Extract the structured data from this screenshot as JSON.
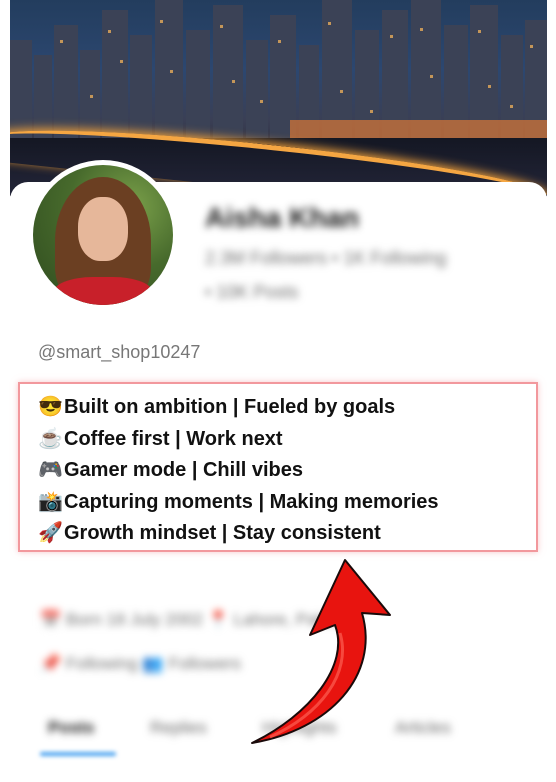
{
  "profile": {
    "name": "Aisha Khan",
    "stats_line1": "2.3M Followers • 1K Following",
    "stats_line2": "• 10K Posts",
    "username": "@smart_shop10247"
  },
  "bio": [
    {
      "emoji": "😎",
      "text": "Built on ambition | Fueled by goals"
    },
    {
      "emoji": "☕",
      "text": "Coffee first | Work next"
    },
    {
      "emoji": "🎮",
      "text": "Gamer mode | Chill vibes"
    },
    {
      "emoji": "📸",
      "text": "Capturing moments | Making memories"
    },
    {
      "emoji": "🚀",
      "text": "Growth mindset | Stay consistent"
    }
  ],
  "meta": {
    "joined": "📅 Born 18 July 2002  📍 Lahore, Pakistan",
    "follow": "📌 Following  👥 Followers"
  },
  "tabs": [
    "Posts",
    "Replies",
    "Highlights",
    "Articles"
  ],
  "colors": {
    "highlight_border": "#f2989d",
    "arrow": "#e8140f",
    "tab_accent": "#4aa3f0"
  }
}
